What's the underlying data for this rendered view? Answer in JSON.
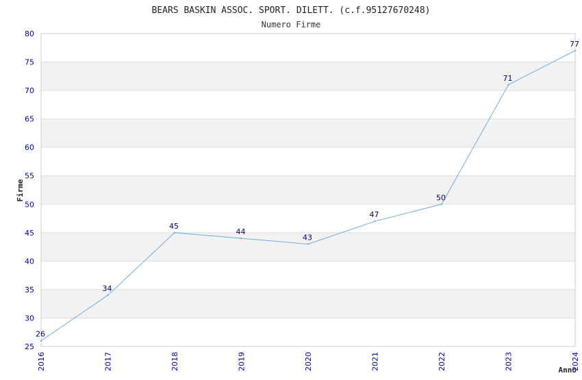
{
  "chart_data": {
    "type": "line",
    "title": "BEARS BASKIN ASSOC. SPORT. DILETT. (c.f.95127670248)",
    "subtitle": "Numero Firme",
    "xlabel": "Anno",
    "ylabel": "Firme",
    "x": [
      "2016",
      "2017",
      "2018",
      "2019",
      "2020",
      "2021",
      "2022",
      "2023",
      "2024"
    ],
    "series": [
      {
        "values": [
          26,
          34,
          45,
          44,
          43,
          47,
          50,
          71,
          77
        ]
      }
    ],
    "ylim": [
      25,
      80
    ],
    "yticks": [
      25,
      30,
      35,
      40,
      45,
      50,
      55,
      60,
      65,
      70,
      75,
      80
    ],
    "grid": true,
    "colors": {
      "line": "#6aaee8",
      "band": "#f2f2f2",
      "gridline": "#dddddd",
      "tick_text": "#0000aa",
      "data_label": "#000066"
    }
  }
}
